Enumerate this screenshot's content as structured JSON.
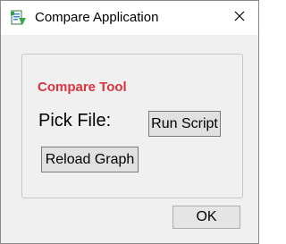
{
  "window": {
    "title": "Compare Application",
    "app_icon": "application-script-icon",
    "close_icon": "close-icon"
  },
  "panel": {
    "heading": "Compare Tool",
    "heading_color": "#d9343f",
    "pick_file_label": "Pick File:",
    "run_script_label": "Run Script",
    "reload_graph_label": "Reload Graph"
  },
  "footer": {
    "ok_label": "OK"
  }
}
